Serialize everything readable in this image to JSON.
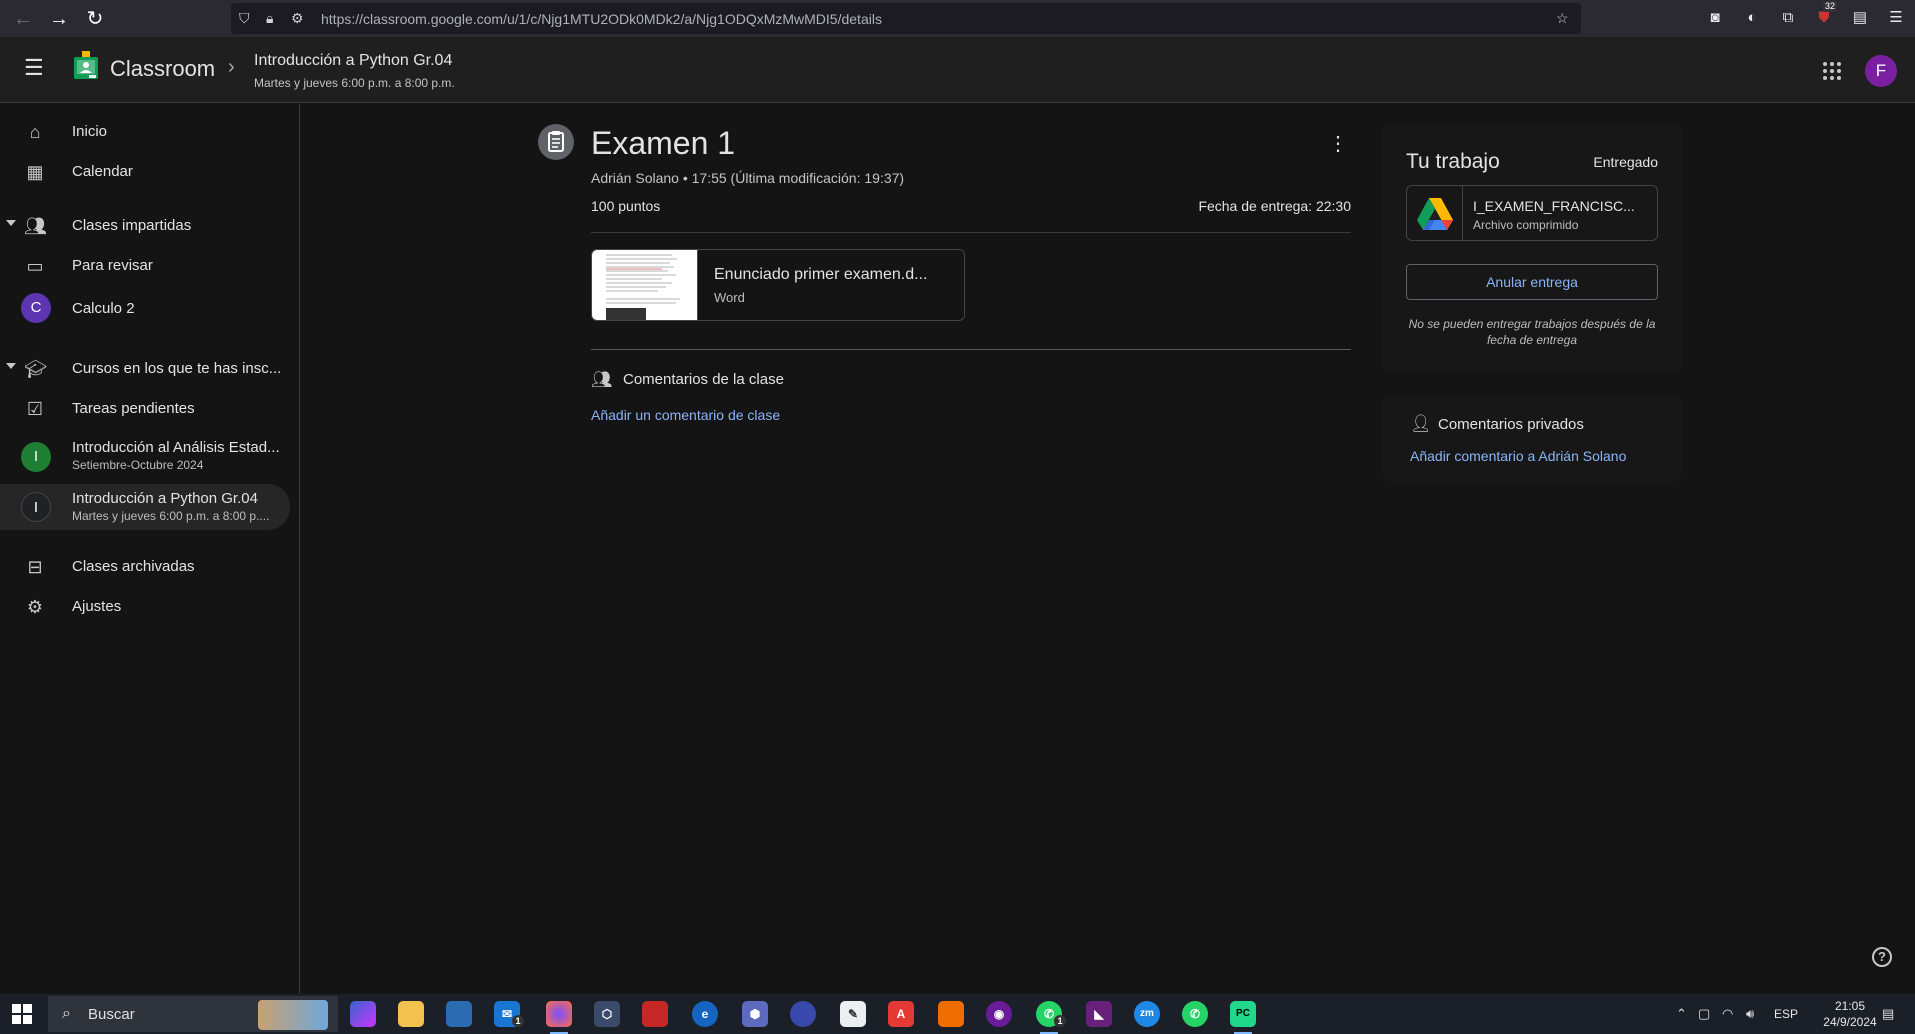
{
  "browser": {
    "url": "https://classroom.google.com/u/1/c/Njg1MTU2ODk0MDk2/a/Njg1ODQxMzMwMDI5/details",
    "badge_count": "32"
  },
  "header": {
    "app_title": "Classroom",
    "course_title": "Introducción a Python Gr.04",
    "course_schedule": "Martes y jueves 6:00 p.m. a 8:00 p.m.",
    "avatar_letter": "F"
  },
  "sidebar": {
    "home": "Inicio",
    "calendar": "Calendar",
    "teaching": "Clases impartidas",
    "to_review": "Para revisar",
    "calc_course": {
      "letter": "C",
      "name": "Calculo 2",
      "color": "#5e35b1"
    },
    "enrolled": "Cursos en los que te has insc...",
    "todo": "Tareas pendientes",
    "course1": {
      "letter": "I",
      "name": "Introducción al Análisis Estad...",
      "sub": "Setiembre-Octubre 2024",
      "color": "#1e7e34"
    },
    "course2": {
      "letter": "I",
      "name": "Introducción a Python Gr.04",
      "sub": "Martes y jueves 6:00 p.m. a 8:00 p....",
      "color": "#202124"
    },
    "archived": "Clases archivadas",
    "settings": "Ajustes"
  },
  "assignment": {
    "title": "Examen 1",
    "meta": "Adrián Solano • 17:55 (Última modificación: 19:37)",
    "points": "100 puntos",
    "due": "Fecha de entrega: 22:30",
    "attachment": {
      "title": "Enunciado primer examen.d...",
      "type": "Word"
    },
    "class_comments_title": "Comentarios de la clase",
    "add_class_comment": "Añadir un comentario de clase"
  },
  "your_work": {
    "title": "Tu trabajo",
    "status": "Entregado",
    "file_name": "I_EXAMEN_FRANCISC...",
    "file_type": "Archivo comprimido",
    "unsubmit_label": "Anular entrega",
    "late_note": "No se pueden entregar trabajos después de la fecha de entrega"
  },
  "private_comments": {
    "title": "Comentarios privados",
    "add_label": "Añadir comentario a Adrián Solano"
  },
  "taskbar": {
    "search_placeholder": "Buscar",
    "lang": "ESP",
    "time": "21:05",
    "date": "24/9/2024",
    "mail_badge": "1",
    "whatsapp_badge": "1"
  },
  "colors": {
    "accent_link": "#8ab4f8",
    "surface": "#141414",
    "header": "#1f1f1f"
  }
}
